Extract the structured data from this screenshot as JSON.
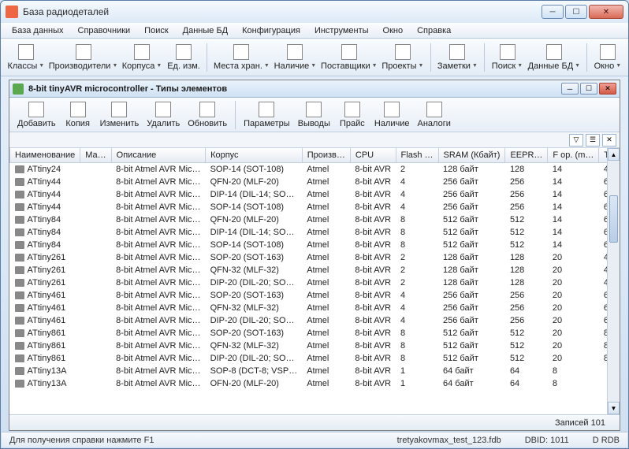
{
  "window": {
    "title": "База радиодеталей"
  },
  "menu": [
    "База данных",
    "Справочники",
    "Поиск",
    "Данные БД",
    "Конфигурация",
    "Инструменты",
    "Окно",
    "Справка"
  ],
  "toolbar": [
    {
      "label": "Классы",
      "dd": true
    },
    {
      "label": "Производители",
      "dd": true
    },
    {
      "label": "Корпуса",
      "dd": true
    },
    {
      "label": "Ед. изм.",
      "dd": false,
      "sep_after": true
    },
    {
      "label": "Места хран.",
      "dd": true
    },
    {
      "label": "Наличие",
      "dd": true
    },
    {
      "label": "Поставщики",
      "dd": true
    },
    {
      "label": "Проекты",
      "dd": true,
      "sep_after": true
    },
    {
      "label": "Заметки",
      "dd": true,
      "sep_after": true
    },
    {
      "label": "Поиск",
      "dd": true
    },
    {
      "label": "Данные БД",
      "dd": true,
      "sep_after": true
    },
    {
      "label": "Окно",
      "dd": true
    }
  ],
  "child": {
    "title": "8-bit tinyAVR microcontroller - Типы элементов",
    "toolbar": [
      {
        "label": "Добавить"
      },
      {
        "label": "Копия"
      },
      {
        "label": "Изменить"
      },
      {
        "label": "Удалить"
      },
      {
        "label": "Обновить",
        "sep_after": true
      },
      {
        "label": "Параметры"
      },
      {
        "label": "Выводы"
      },
      {
        "label": "Прайс"
      },
      {
        "label": "Наличие"
      },
      {
        "label": "Аналоги"
      }
    ],
    "columns": [
      "Наименование",
      "Ма…",
      "Описание",
      "Корпус",
      "Произв…",
      "CPU",
      "Flash …",
      "SRAM (Кбайт)",
      "EEPR…",
      "F op. (m…",
      "Touch C"
    ],
    "rows": [
      [
        "ATtiny24",
        "",
        "8-bit Atmel AVR Mic…",
        "SOP-14 (SOT-108)",
        "Atmel",
        "8-bit AVR",
        "2",
        "128 байт",
        "128",
        "14",
        "4"
      ],
      [
        "ATtiny44",
        "",
        "8-bit Atmel AVR Mic…",
        "QFN-20 (MLF-20)",
        "Atmel",
        "8-bit AVR",
        "4",
        "256 байт",
        "256",
        "14",
        "6"
      ],
      [
        "ATtiny44",
        "",
        "8-bit Atmel AVR Mic…",
        "DIP-14 (DIL-14; SO…",
        "Atmel",
        "8-bit AVR",
        "4",
        "256 байт",
        "256",
        "14",
        "6"
      ],
      [
        "ATtiny44",
        "",
        "8-bit Atmel AVR Mic…",
        "SOP-14 (SOT-108)",
        "Atmel",
        "8-bit AVR",
        "4",
        "256 байт",
        "256",
        "14",
        "6"
      ],
      [
        "ATtiny84",
        "",
        "8-bit Atmel AVR Mic…",
        "QFN-20 (MLF-20)",
        "Atmel",
        "8-bit AVR",
        "8",
        "512 байт",
        "512",
        "14",
        "6"
      ],
      [
        "ATtiny84",
        "",
        "8-bit Atmel AVR Mic…",
        "DIP-14 (DIL-14; SO…",
        "Atmel",
        "8-bit AVR",
        "8",
        "512 байт",
        "512",
        "14",
        "6"
      ],
      [
        "ATtiny84",
        "",
        "8-bit Atmel AVR Mic…",
        "SOP-14 (SOT-108)",
        "Atmel",
        "8-bit AVR",
        "8",
        "512 байт",
        "512",
        "14",
        "6"
      ],
      [
        "ATtiny261",
        "",
        "8-bit Atmel AVR Mic…",
        "SOP-20 (SOT-163)",
        "Atmel",
        "8-bit AVR",
        "2",
        "128 байт",
        "128",
        "20",
        "4"
      ],
      [
        "ATtiny261",
        "",
        "8-bit Atmel AVR Mic…",
        "QFN-32 (MLF-32)",
        "Atmel",
        "8-bit AVR",
        "2",
        "128 байт",
        "128",
        "20",
        "4"
      ],
      [
        "ATtiny261",
        "",
        "8-bit Atmel AVR Mic…",
        "DIP-20 (DIL-20; SO…",
        "Atmel",
        "8-bit AVR",
        "2",
        "128 байт",
        "128",
        "20",
        "4"
      ],
      [
        "ATtiny461",
        "",
        "8-bit Atmel AVR Mic…",
        "SOP-20 (SOT-163)",
        "Atmel",
        "8-bit AVR",
        "4",
        "256 байт",
        "256",
        "20",
        "6"
      ],
      [
        "ATtiny461",
        "",
        "8-bit Atmel AVR Mic…",
        "QFN-32 (MLF-32)",
        "Atmel",
        "8-bit AVR",
        "4",
        "256 байт",
        "256",
        "20",
        "6"
      ],
      [
        "ATtiny461",
        "",
        "8-bit Atmel AVR Mic…",
        "DIP-20 (DIL-20; SO…",
        "Atmel",
        "8-bit AVR",
        "4",
        "256 байт",
        "256",
        "20",
        "6"
      ],
      [
        "ATtiny861",
        "",
        "8-bit Atmel AVR Mic…",
        "SOP-20 (SOT-163)",
        "Atmel",
        "8-bit AVR",
        "8",
        "512 байт",
        "512",
        "20",
        "8"
      ],
      [
        "ATtiny861",
        "",
        "8-bit Atmel AVR Mic…",
        "QFN-32 (MLF-32)",
        "Atmel",
        "8-bit AVR",
        "8",
        "512 байт",
        "512",
        "20",
        "8"
      ],
      [
        "ATtiny861",
        "",
        "8-bit Atmel AVR Mic…",
        "DIP-20 (DIL-20; SO…",
        "Atmel",
        "8-bit AVR",
        "8",
        "512 байт",
        "512",
        "20",
        "8"
      ],
      [
        "ATtiny13A",
        "",
        "8-bit Atmel AVR Mic…",
        "SOP-8 (DCT-8; VSP…",
        "Atmel",
        "8-bit AVR",
        "1",
        "64 байт",
        "64",
        "8",
        ""
      ],
      [
        "ATtiny13A",
        "",
        "8-bit Atmel AVR Mic…",
        "OFN-20 (MLF-20)",
        "Atmel",
        "8-bit AVR",
        "1",
        "64 байт",
        "64",
        "8",
        ""
      ]
    ],
    "status": "Записей 101"
  },
  "status": {
    "hint": "Для получения справки нажмите F1",
    "db": "tretyakovmax_test_123.fdb",
    "dbid": "DBID: 1011",
    "mode": "D RDB"
  }
}
